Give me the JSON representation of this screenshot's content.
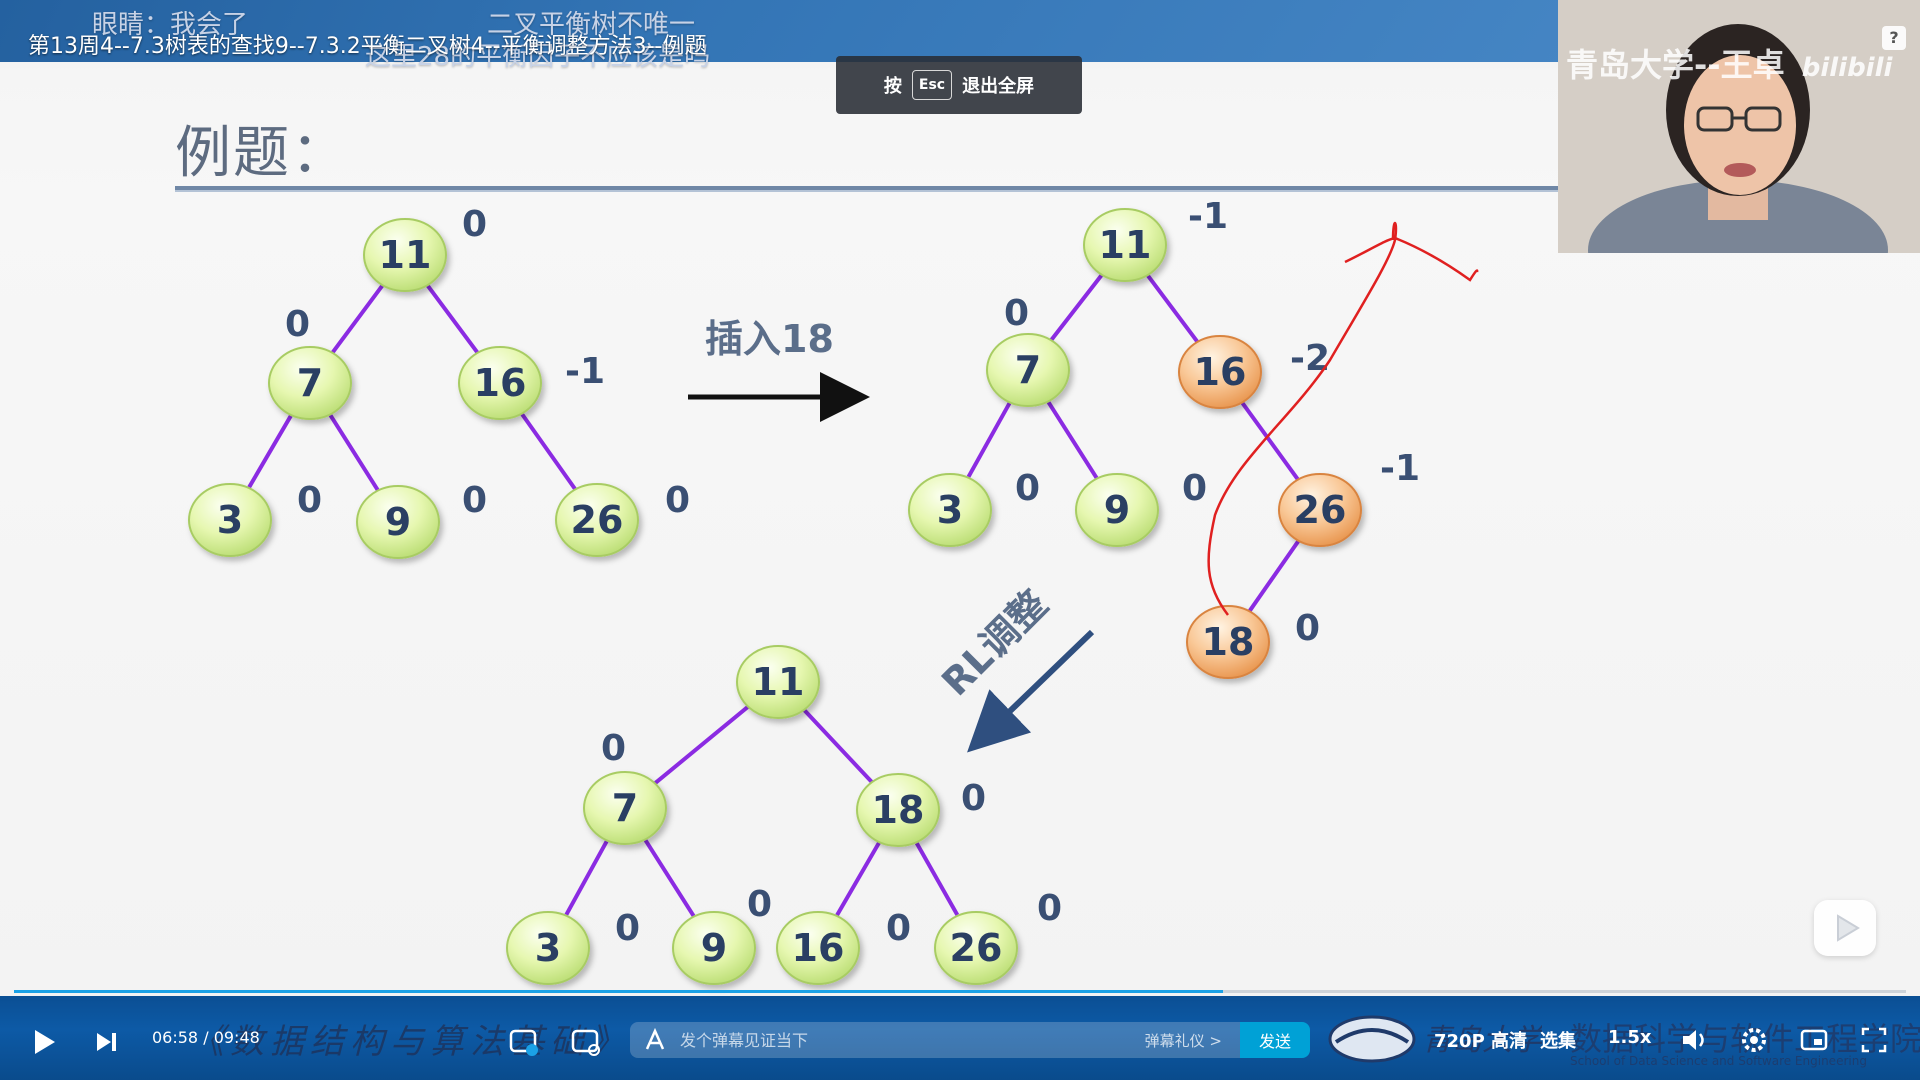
{
  "video": {
    "title": "第13周4--7.3树表的查找9--7.3.2平衡二叉树4--平衡调整方法3--例题",
    "danmaku": [
      {
        "text": "眼睛：我会了"
      },
      {
        "text": "二叉平衡树不唯一"
      },
      {
        "text": "这里28的平衡因子不应该是吗"
      }
    ],
    "esc_hint": {
      "prefix": "按",
      "key": "Esc",
      "suffix": "退出全屏"
    }
  },
  "slide": {
    "heading": "例题：",
    "insert_label": "插入18",
    "rl_label": "RL调整",
    "trees": {
      "before": {
        "nodes": [
          {
            "key": "11",
            "bf": "0"
          },
          {
            "key": "7",
            "bf": "0"
          },
          {
            "key": "16",
            "bf": "-1"
          },
          {
            "key": "3",
            "bf": "0"
          },
          {
            "key": "9",
            "bf": "0"
          },
          {
            "key": "26",
            "bf": "0"
          }
        ]
      },
      "after_insert": {
        "nodes": [
          {
            "key": "11",
            "bf": "-1"
          },
          {
            "key": "7",
            "bf": "0"
          },
          {
            "key": "16",
            "bf": "-2",
            "highlight": true
          },
          {
            "key": "3",
            "bf": "0"
          },
          {
            "key": "9",
            "bf": "0"
          },
          {
            "key": "26",
            "bf": "-1",
            "highlight": true
          },
          {
            "key": "18",
            "bf": "0",
            "highlight": true
          }
        ]
      },
      "adjusted": {
        "nodes": [
          {
            "key": "11",
            "bf": ""
          },
          {
            "key": "7",
            "bf": "0"
          },
          {
            "key": "18",
            "bf": "0"
          },
          {
            "key": "3",
            "bf": "0"
          },
          {
            "key": "9",
            "bf": "0"
          },
          {
            "key": "16",
            "bf": "0"
          },
          {
            "key": "26",
            "bf": "0"
          }
        ]
      }
    },
    "colors": {
      "normal_node": "#dff5a8",
      "highlight_node": "#f8c08a",
      "edge": "#8b2be2",
      "annotation": "#e02020"
    }
  },
  "webcam": {
    "watermark": "青岛大学--王卓",
    "brand": "bilibili",
    "help": "?"
  },
  "footer": {
    "course": "《数据结构与算法基础》",
    "school_cn": "数据科学与软件工程学院",
    "school_en": "School of Data Science and Software Engineering",
    "university": "青岛大学"
  },
  "controls": {
    "current_time": "06:58",
    "total_time": "09:48",
    "progress": 0.71,
    "danmaku_placeholder": "发个弹幕见证当下",
    "danmaku_etiquette": "弹幕礼仪 >",
    "send_label": "发送",
    "quality_label": "720P 高清",
    "episodes_label": "选集",
    "speed_label": "1.5x"
  }
}
